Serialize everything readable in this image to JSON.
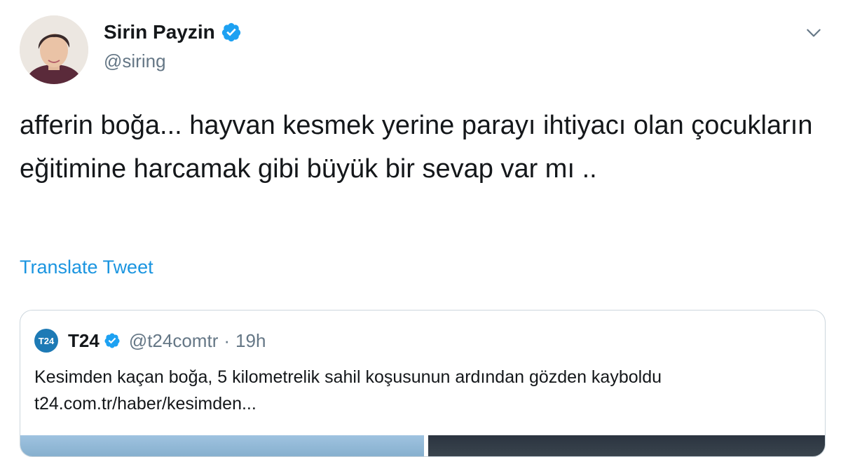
{
  "author": {
    "display_name": "Sirin Payzin",
    "handle": "@siring",
    "verified": true
  },
  "tweet": {
    "text": "afferin boğa... hayvan kesmek yerine parayı ihtiyacı olan çocukların eğitimine harcamak gibi büyük bir sevap var mı ..",
    "translate_label": "Translate Tweet"
  },
  "quoted_tweet": {
    "avatar_text": "T24",
    "display_name": "T24",
    "handle": "@t24comtr",
    "separator": "·",
    "time": "19h",
    "text": "Kesimden kaçan boğa, 5 kilometrelik sahil koşusunun ardından gözden kayboldu",
    "link": "t24.com.tr/haber/kesimden..."
  },
  "icons": {
    "verified": "verified-badge-icon",
    "menu": "chevron-down-icon"
  },
  "colors": {
    "link_blue": "#1b95e0",
    "verified_blue": "#1da1f2",
    "secondary_text": "#657786",
    "primary_text": "#14171a",
    "border": "#ccd6dd"
  }
}
